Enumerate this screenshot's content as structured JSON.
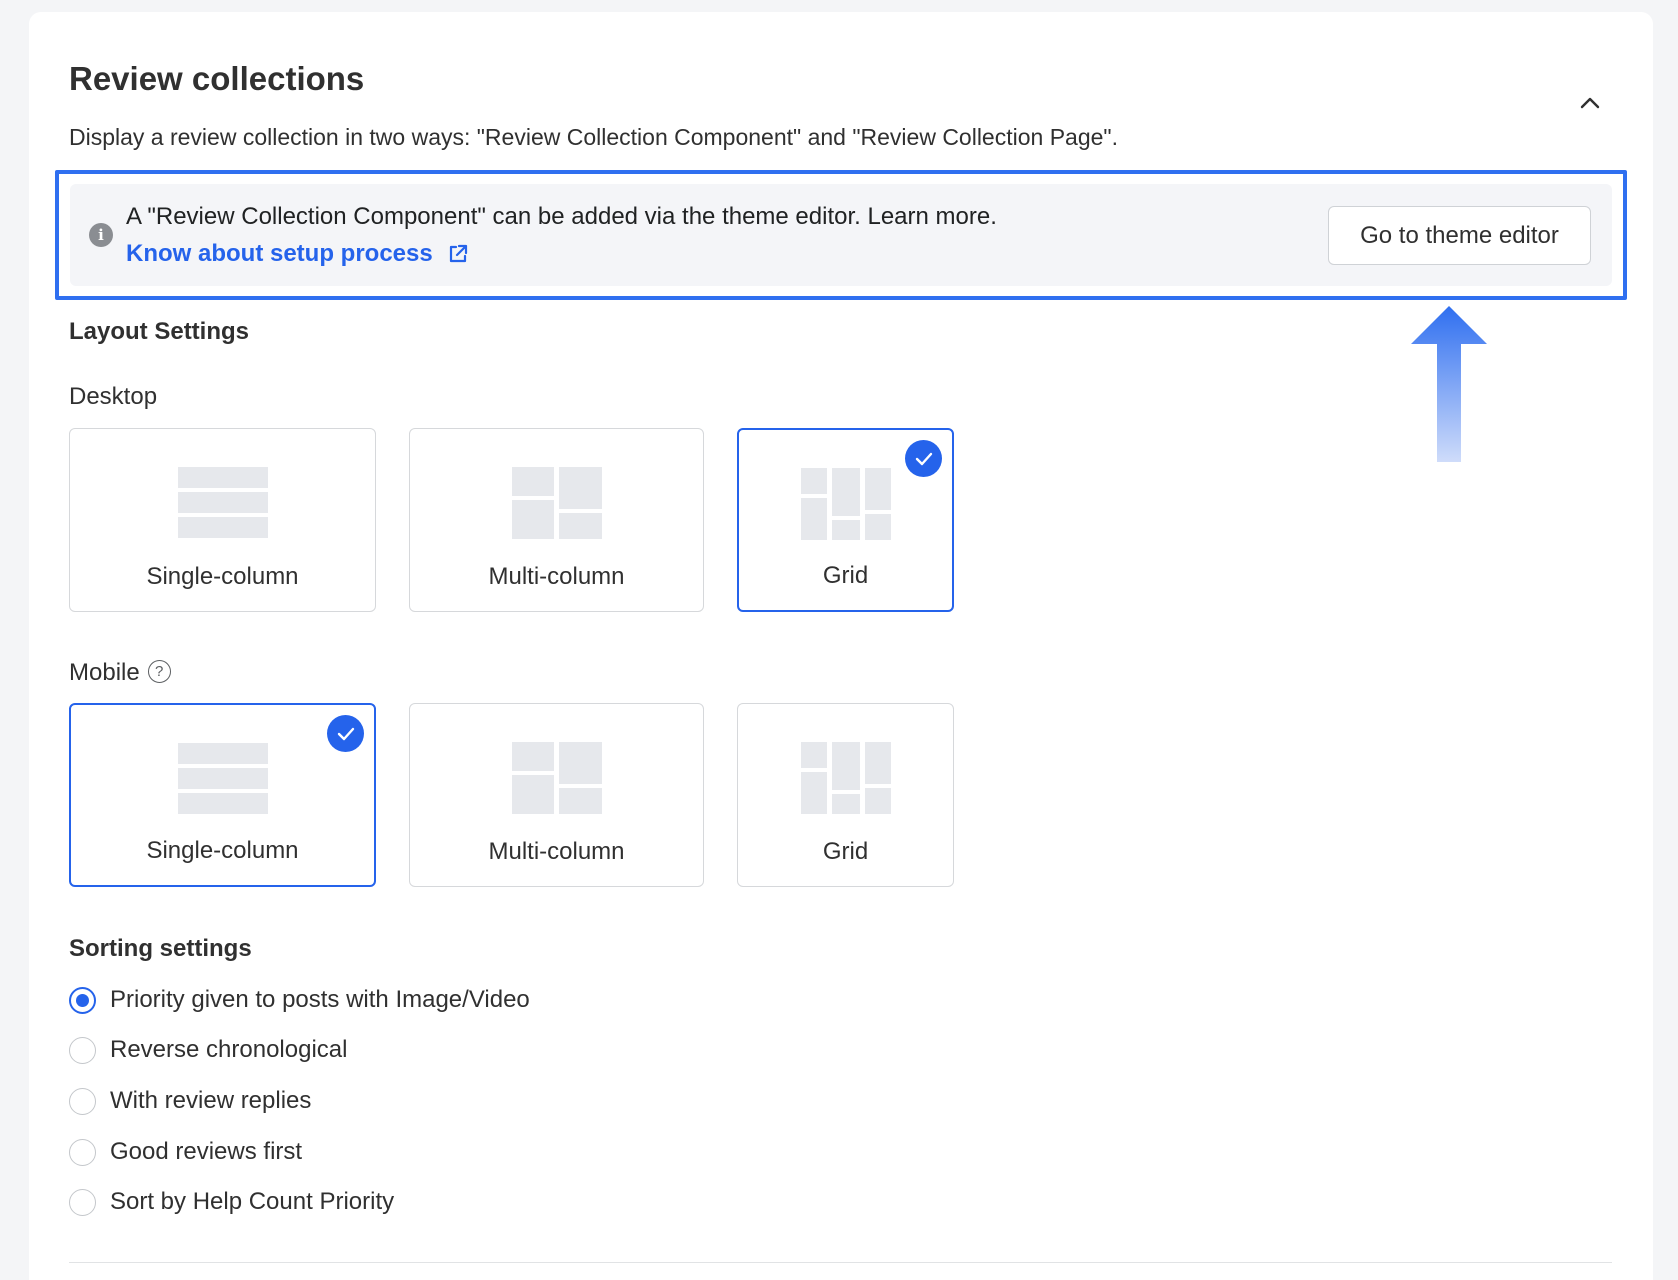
{
  "section": {
    "title": "Review collections",
    "subtitle": "Display a review collection in two ways: \"Review Collection Component\" and \"Review Collection Page\"."
  },
  "banner": {
    "text": "A \"Review Collection Component\" can be added via the theme editor. Learn more.",
    "link_label": "Know about setup process",
    "button_label": "Go to theme editor",
    "highlight_color": "#2f6ff0"
  },
  "layout": {
    "heading": "Layout Settings",
    "desktop": {
      "label": "Desktop",
      "options": [
        {
          "label": "Single-column",
          "selected": false
        },
        {
          "label": "Multi-column",
          "selected": false
        },
        {
          "label": "Grid",
          "selected": true
        }
      ]
    },
    "mobile": {
      "label": "Mobile",
      "options": [
        {
          "label": "Single-column",
          "selected": true
        },
        {
          "label": "Multi-column",
          "selected": false
        },
        {
          "label": "Grid",
          "selected": false
        }
      ]
    }
  },
  "sorting": {
    "heading": "Sorting settings",
    "options": [
      {
        "label": "Priority given to posts with Image/Video",
        "checked": true
      },
      {
        "label": "Reverse chronological",
        "checked": false
      },
      {
        "label": "With review replies",
        "checked": false
      },
      {
        "label": "Good reviews first",
        "checked": false
      },
      {
        "label": "Sort by Help Count Priority",
        "checked": false
      }
    ]
  },
  "colors": {
    "accent": "#2563eb",
    "text": "#303030"
  }
}
